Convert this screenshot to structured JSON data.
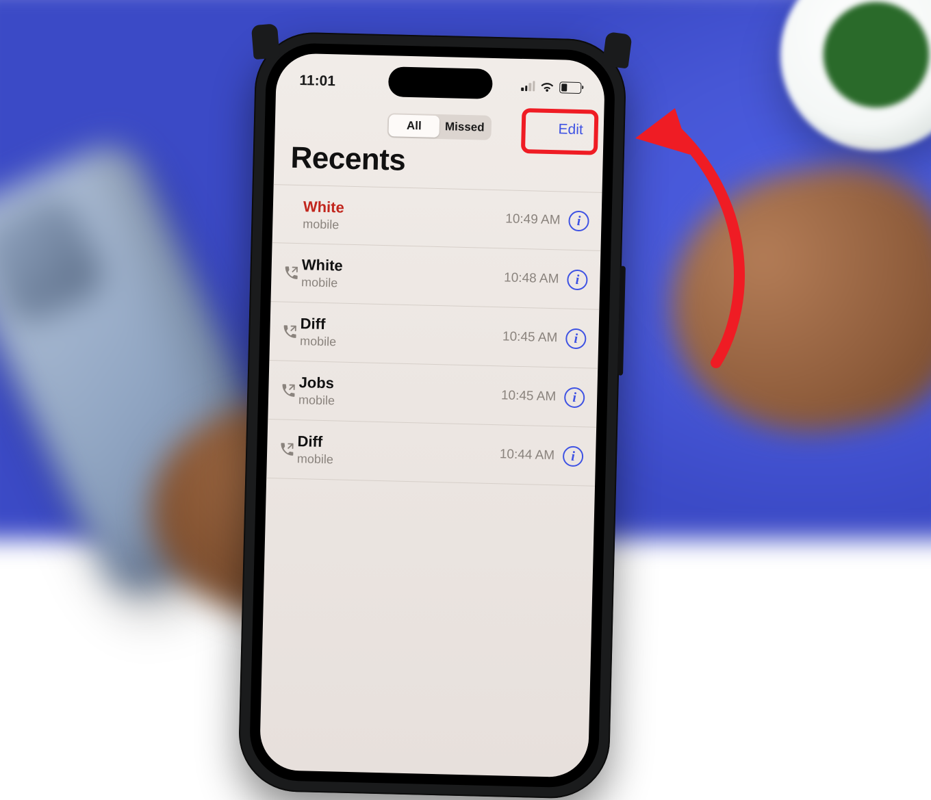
{
  "status": {
    "time": "11:01"
  },
  "navbar": {
    "segments": {
      "all": "All",
      "missed": "Missed"
    },
    "edit": "Edit"
  },
  "title": "Recents",
  "calls": [
    {
      "name": "White",
      "type": "mobile",
      "time": "10:49 AM",
      "missed": true,
      "outgoing": false
    },
    {
      "name": "White",
      "type": "mobile",
      "time": "10:48 AM",
      "missed": false,
      "outgoing": true
    },
    {
      "name": "Diff",
      "type": "mobile",
      "time": "10:45 AM",
      "missed": false,
      "outgoing": true
    },
    {
      "name": "Jobs",
      "type": "mobile",
      "time": "10:45 AM",
      "missed": false,
      "outgoing": true
    },
    {
      "name": "Diff",
      "type": "mobile",
      "time": "10:44 AM",
      "missed": false,
      "outgoing": true
    }
  ]
}
